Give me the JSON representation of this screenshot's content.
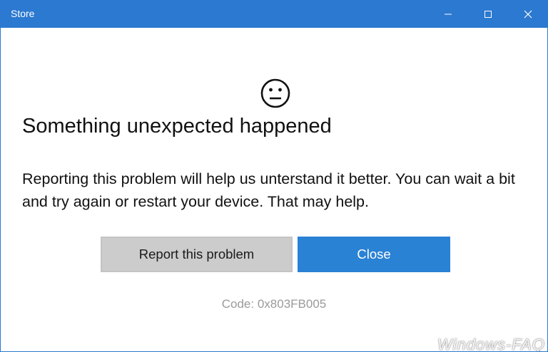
{
  "window": {
    "title": "Store",
    "accent_color": "#2b79d0"
  },
  "titlebar_buttons": {
    "minimize_icon": "minimize-icon",
    "maximize_icon": "maximize-icon",
    "close_icon": "close-icon"
  },
  "error": {
    "icon": "neutral-face-icon",
    "heading": "Something unexpected happened",
    "message": "Reporting this problem will help us unterstand it better. You can wait a bit and try again or restart your device. That may help.",
    "code": "Code: 0x803FB005"
  },
  "actions": {
    "report_label": "Report this problem",
    "close_label": "Close",
    "close_color": "#2a82d4"
  },
  "watermark": {
    "text": "Windows-FAQ"
  }
}
